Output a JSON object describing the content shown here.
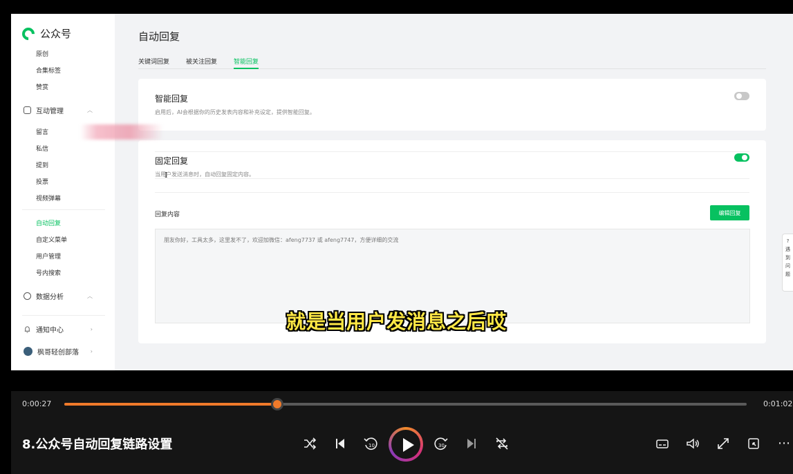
{
  "sidebar": {
    "brand": "公众号",
    "items_top": [
      "原创",
      "合集标签",
      "赞赏"
    ],
    "group_interaction": "互动管理",
    "items_interaction": [
      "留言",
      "私信",
      "提到",
      "投票",
      "视频弹幕"
    ],
    "items_more": [
      "自动回复",
      "自定义菜单",
      "用户管理",
      "号内搜索"
    ],
    "group_analytics": "数据分析",
    "notify": "通知中心",
    "account": "枫哥轻创部落"
  },
  "main": {
    "title": "自动回复",
    "tabs": [
      "关键词回复",
      "被关注回复",
      "智能回复"
    ],
    "smart_card": {
      "title": "智能回复",
      "desc": "启用后，AI会根据你的历史发表内容和补充设定，提供智能回复。",
      "enabled": false
    },
    "fixed_card": {
      "title": "固定回复",
      "desc": "当用户发送消息时，自动回复固定内容。",
      "enabled": true,
      "reply_label": "回复内容",
      "edit_button": "编辑回复",
      "reply_text": "朋友你好，工具太多，这里发不了，欢迎加微信：afeng7737 或 afeng7747，方便详细的交流"
    },
    "helper_text": [
      "遇",
      "到",
      "问",
      "题"
    ]
  },
  "subtitle": "就是当用户发消息之后哎",
  "player": {
    "current_time": "0:00:27",
    "total_time": "0:01:02",
    "progress": 0.312,
    "video_title": "8.公众号自动回复链路设置",
    "accent": "#f07a2a"
  }
}
